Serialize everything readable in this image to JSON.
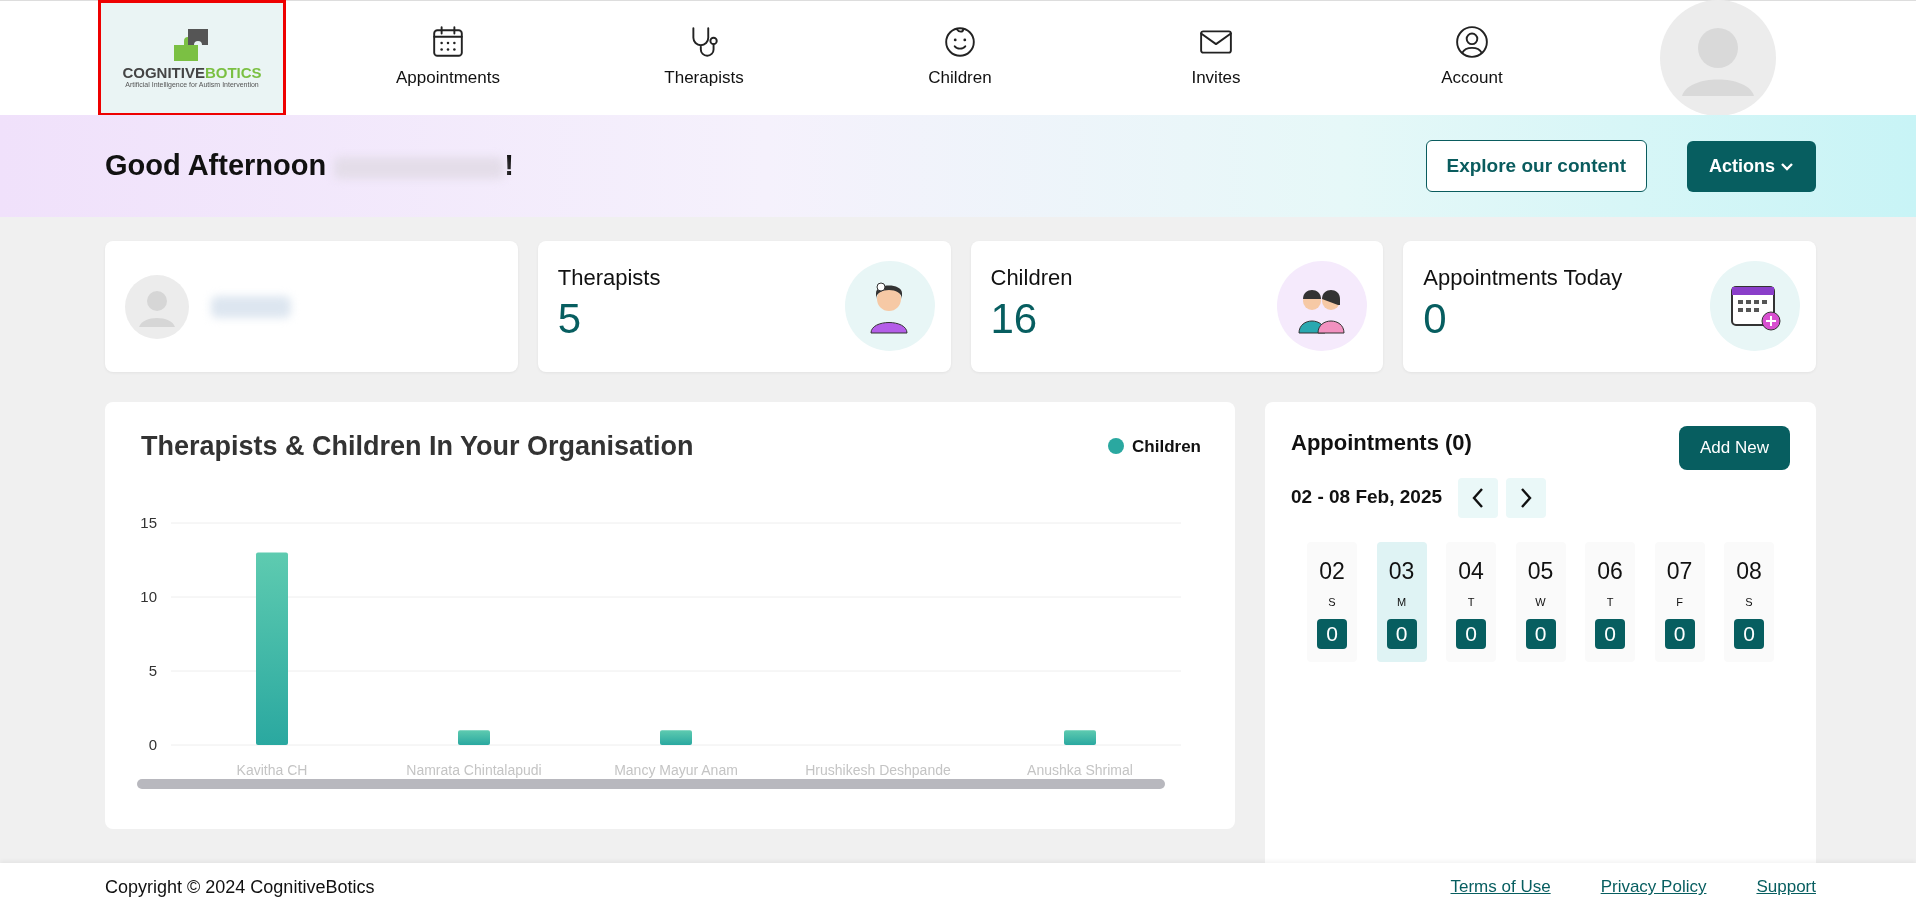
{
  "nav": {
    "logo": {
      "word1": "COGNITIVE",
      "word2": "BOTICS",
      "tagline": "Artificial Intelligence for Autism Intervention"
    },
    "items": [
      {
        "label": "Appointments"
      },
      {
        "label": "Therapists"
      },
      {
        "label": "Children"
      },
      {
        "label": "Invites"
      },
      {
        "label": "Account"
      }
    ]
  },
  "banner": {
    "greeting": "Good Afternoon",
    "greeting_end": "!",
    "explore_button": "Explore our content",
    "actions_button": "Actions"
  },
  "stats": [
    {
      "label": "Therapists",
      "value": "5"
    },
    {
      "label": "Children",
      "value": "16"
    },
    {
      "label": "Appointments Today",
      "value": "0"
    }
  ],
  "chart_card": {
    "title": "Therapists & Children In Your Organisation",
    "chart_data": {
      "type": "bar",
      "categories": [
        "Kavitha CH",
        "Namrata Chintalapudi",
        "Mancy Mayur Anam",
        "Hrushikesh Deshpande",
        "Anushka Shrimal"
      ],
      "series": [
        {
          "name": "Children",
          "color": "#2aa8a0",
          "values": [
            13,
            1,
            1,
            0,
            1
          ]
        }
      ],
      "ylim": [
        0,
        15
      ],
      "yticks": [
        0,
        5,
        10,
        15
      ]
    }
  },
  "appointments": {
    "title": "Appointments (0)",
    "add_button": "Add New",
    "range": "02 - 08 Feb, 2025",
    "days": [
      {
        "date": "02",
        "weekday": "S",
        "count": "0",
        "selected": false
      },
      {
        "date": "03",
        "weekday": "M",
        "count": "0",
        "selected": true
      },
      {
        "date": "04",
        "weekday": "T",
        "count": "0",
        "selected": false
      },
      {
        "date": "05",
        "weekday": "W",
        "count": "0",
        "selected": false
      },
      {
        "date": "06",
        "weekday": "T",
        "count": "0",
        "selected": false
      },
      {
        "date": "07",
        "weekday": "F",
        "count": "0",
        "selected": false
      },
      {
        "date": "08",
        "weekday": "S",
        "count": "0",
        "selected": false
      }
    ]
  },
  "footer": {
    "copyright": "Copyright © 2024 CognitiveBotics",
    "links": [
      "Terms of Use",
      "Privacy Policy",
      "Support"
    ]
  }
}
